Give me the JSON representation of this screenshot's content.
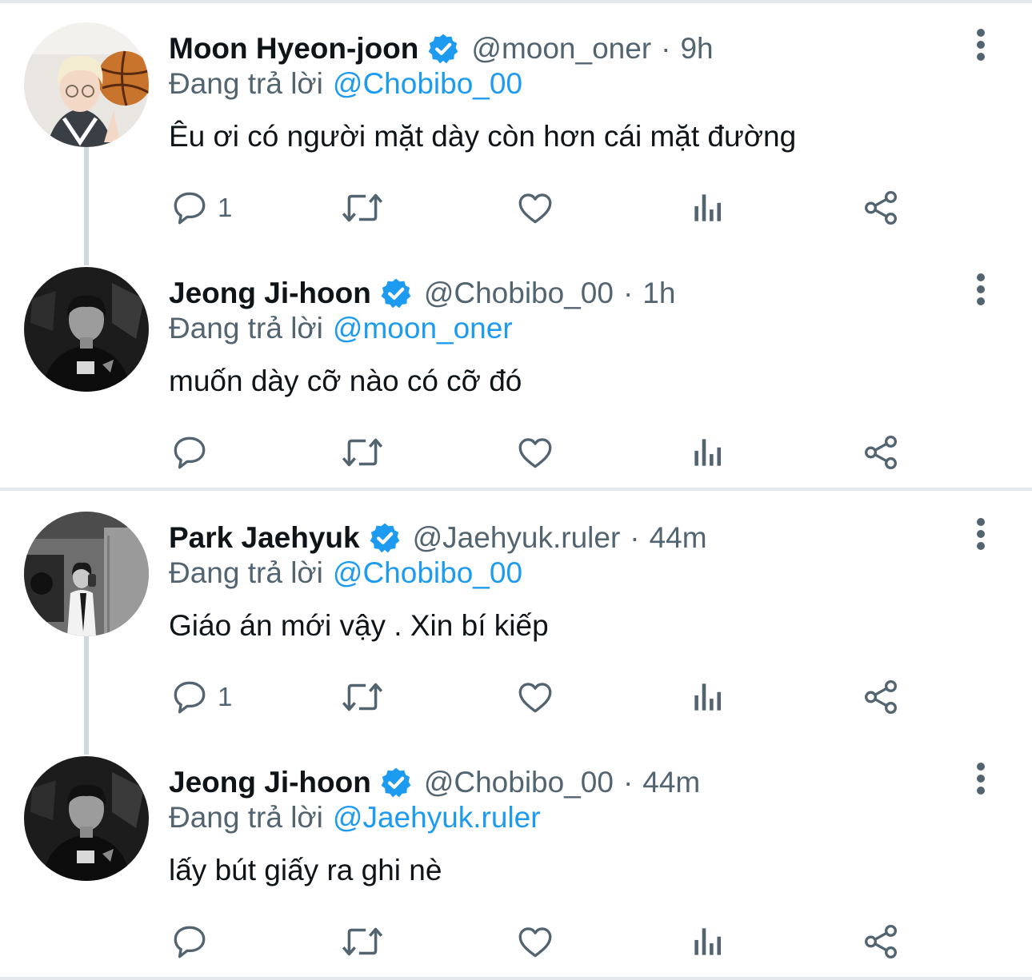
{
  "tweets": [
    {
      "name": "Moon Hyeon-joon",
      "handle": "@moon_oner",
      "dot": "·",
      "time": "9h",
      "reply_prefix": "Đang trả lời",
      "reply_to": "@Chobibo_00",
      "text": "Êu ơi có người mặt dày còn hơn cái mặt đường",
      "reply_count": "1"
    },
    {
      "name": "Jeong Ji-hoon",
      "handle": "@Chobibo_00",
      "dot": "·",
      "time": "1h",
      "reply_prefix": "Đang trả lời",
      "reply_to": "@moon_oner",
      "text": "muốn dày cỡ nào có cỡ đó",
      "reply_count": ""
    },
    {
      "name": "Park Jaehyuk",
      "handle": "@Jaehyuk.ruler",
      "dot": "·",
      "time": "44m",
      "reply_prefix": "Đang trả lời",
      "reply_to": "@Chobibo_00",
      "text": "Giáo án mới vậy . Xin bí kiếp",
      "reply_count": "1"
    },
    {
      "name": "Jeong Ji-hoon",
      "handle": "@Chobibo_00",
      "dot": "·",
      "time": "44m",
      "reply_prefix": "Đang trả lời",
      "reply_to": "@Jaehyuk.ruler",
      "text": "lấy bút giấy ra ghi nè",
      "reply_count": ""
    }
  ],
  "icons": {
    "reply": "reply-icon",
    "retweet": "retweet-icon",
    "like": "heart-icon",
    "views": "views-icon",
    "share": "share-icon",
    "more": "more-icon",
    "verified": "verified-badge-icon"
  },
  "colors": {
    "text": "#0f1419",
    "muted": "#536471",
    "accent": "#1d9bf0",
    "divider": "#e6e9ec",
    "thread_line": "#cfd9de"
  }
}
